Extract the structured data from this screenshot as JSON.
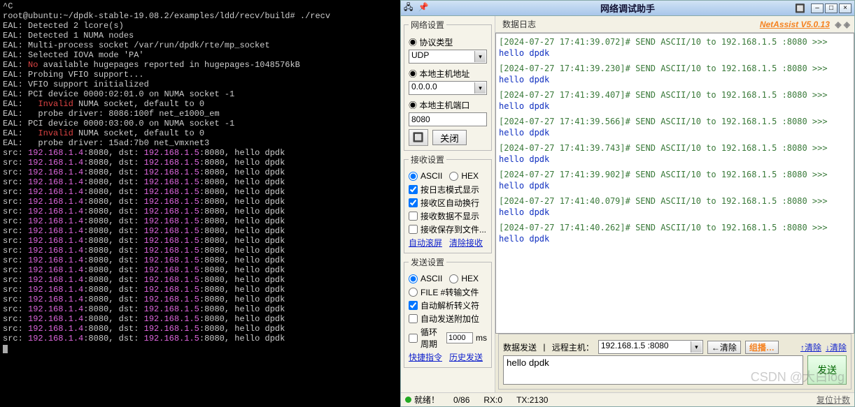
{
  "terminal": {
    "prompt_prefix": "root@ubuntu:~/dpdk-stable-19.08.2/examples/ldd/recv/build# ",
    "cmd": "./recv",
    "ctrlc": "^C",
    "lines": [
      "EAL: Detected 2 lcore(s)",
      "EAL: Detected 1 NUMA nodes",
      "EAL: Multi-process socket /var/run/dpdk/rte/mp_socket",
      "EAL: Selected IOVA mode 'PA'"
    ],
    "huge_l": "EAL: ",
    "huge_no": "No",
    "huge_r": " available hugepages reported in hugepages-1048576kB",
    "lines2": [
      "EAL: Probing VFIO support...",
      "EAL: VFIO support initialized",
      "EAL: PCI device 0000:02:01.0 on NUMA socket -1"
    ],
    "inv1_l": "EAL:   ",
    "inv1_m": "Invalid",
    "inv1_r": " NUMA socket, default to 0",
    "drv1": "EAL:   probe driver: 8086:100f net_e1000_em",
    "pci2": "EAL: PCI device 0000:03:00.0 on NUMA socket -1",
    "inv2_l": "EAL:   ",
    "inv2_m": "Invalid",
    "inv2_r": " NUMA socket, default to 0",
    "drv2": "EAL:   probe driver: 15ad:7b0 net_vmxnet3",
    "pkt_src_pre": "src: ",
    "pkt_src_ip": "192.168.1.4",
    "pkt_src_port": ":8080, dst: ",
    "pkt_dst_ip": "192.168.1.5",
    "pkt_tail": ":8080, hello dpdk",
    "pkt_count": 20
  },
  "win": {
    "title": "网络调试助手",
    "brand": "NetAssist V5.0.13",
    "side": {
      "net": {
        "legend": "网络设置",
        "proto_lbl": "协议类型",
        "proto_val": "UDP",
        "host_lbl": "本地主机地址",
        "host_val": "0.0.0.0",
        "port_lbl": "本地主机端口",
        "port_val": "8080",
        "close_btn": "关闭"
      },
      "recv": {
        "legend": "接收设置",
        "r_ascii": "ASCII",
        "r_hex": "HEX",
        "chk_logmode": "按日志模式显示",
        "chk_wrap": "接收区自动换行",
        "chk_hide": "接收数据不显示",
        "chk_save": "接收保存到文件...",
        "link_auto": "自动滚屏",
        "link_clear": "清除接收"
      },
      "send": {
        "legend": "发送设置",
        "r_ascii": "ASCII",
        "r_hex": "HEX",
        "chk_file": "FILE #转输文件",
        "chk_esc": "自动解析转义符",
        "chk_at": "自动发送附加位",
        "chk_loop_l": "循环周期",
        "loop_val": "1000",
        "chk_loop_r": "ms",
        "link_quick": "快捷指令",
        "link_hist": "历史发送"
      }
    },
    "data": {
      "legend": "数据日志",
      "entries": [
        {
          "ts": "[2024-07-27 17:41:39.072]# SEND ASCII/10 to 192.168.1.5 :8080 >>>",
          "msg": "hello dpdk"
        },
        {
          "ts": "[2024-07-27 17:41:39.230]# SEND ASCII/10 to 192.168.1.5 :8080 >>>",
          "msg": "hello dpdk"
        },
        {
          "ts": "[2024-07-27 17:41:39.407]# SEND ASCII/10 to 192.168.1.5 :8080 >>>",
          "msg": "hello dpdk"
        },
        {
          "ts": "[2024-07-27 17:41:39.566]# SEND ASCII/10 to 192.168.1.5 :8080 >>>",
          "msg": "hello dpdk"
        },
        {
          "ts": "[2024-07-27 17:41:39.743]# SEND ASCII/10 to 192.168.1.5 :8080 >>>",
          "msg": "hello dpdk"
        },
        {
          "ts": "[2024-07-27 17:41:39.902]# SEND ASCII/10 to 192.168.1.5 :8080 >>>",
          "msg": "hello dpdk"
        },
        {
          "ts": "[2024-07-27 17:41:40.079]# SEND ASCII/10 to 192.168.1.5 :8080 >>>",
          "msg": "hello dpdk"
        },
        {
          "ts": "[2024-07-27 17:41:40.262]# SEND ASCII/10 to 192.168.1.5 :8080 >>>",
          "msg": "hello dpdk"
        }
      ]
    },
    "sendbar": {
      "legend": "数据发送",
      "remote_lbl": "远程主机：",
      "remote_val": "192.168.1.5 :8080",
      "clear_btn": "←清除",
      "grp_btn": "组播…",
      "clear2": "↑清除",
      "clear3": "↓清除",
      "text": "hello dpdk",
      "send_btn": "发送"
    },
    "status": {
      "ready": "就绪！",
      "rx": "RX:0",
      "tx": "TX:2130",
      "reset": "复位计数"
    },
    "watermark": "CSDN @大白log"
  }
}
